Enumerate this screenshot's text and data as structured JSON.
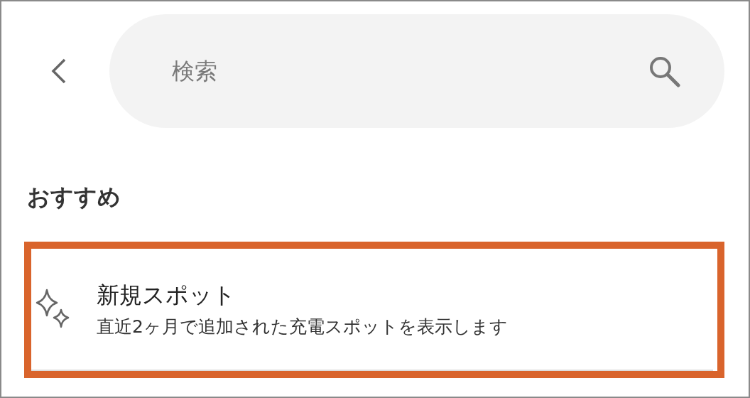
{
  "search": {
    "placeholder": "検索"
  },
  "section": {
    "title": "おすすめ"
  },
  "items": [
    {
      "title": "新規スポット",
      "subtitle": "直近2ヶ月で追加された充電スポットを表示します",
      "highlighted": true
    }
  ]
}
